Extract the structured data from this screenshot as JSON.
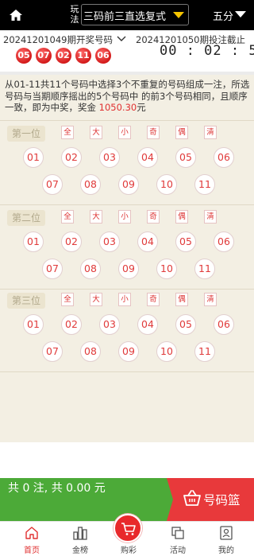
{
  "header": {
    "play_label": "玩法",
    "play_type": "三码前三直选复式",
    "game": "五分"
  },
  "draw": {
    "prev_issue": "20241201049期开奖号码",
    "prev_numbers": [
      "05",
      "07",
      "02",
      "11",
      "06"
    ],
    "current_issue": "20241201050期投注截止",
    "countdown": "00 : 02 : 54"
  },
  "description": {
    "text": "从01-11共11个号码中选择3个不重复的号码组成一注，所选号码与当期顺序摇出的5个号码中 的前3个号码相同，且顺序一致，即为中奖，奖金 ",
    "prize": "1050.30",
    "suffix": "元"
  },
  "filters": [
    "全",
    "大",
    "小",
    "奇",
    "偶",
    "清"
  ],
  "positions": [
    {
      "label": "第一位",
      "numbers": [
        "01",
        "02",
        "03",
        "04",
        "05",
        "06",
        "07",
        "08",
        "09",
        "10",
        "11"
      ]
    },
    {
      "label": "第二位",
      "numbers": [
        "01",
        "02",
        "03",
        "04",
        "05",
        "06",
        "07",
        "08",
        "09",
        "10",
        "11"
      ]
    },
    {
      "label": "第三位",
      "numbers": [
        "01",
        "02",
        "03",
        "04",
        "05",
        "06",
        "07",
        "08",
        "09",
        "10",
        "11"
      ]
    }
  ],
  "bet": {
    "summary": "共 0 注, 共 0.00 元",
    "basket_label": "号码篮"
  },
  "tabs": [
    {
      "label": "首页",
      "icon": "home-icon"
    },
    {
      "label": "金榜",
      "icon": "leaderboard-icon"
    },
    {
      "label": "购彩",
      "icon": "cart-icon"
    },
    {
      "label": "活动",
      "icon": "activity-icon"
    },
    {
      "label": "我的",
      "icon": "profile-icon"
    }
  ],
  "colors": {
    "accent_red": "#e8393b",
    "bet_green": "#4caa38",
    "countdown_text": "#222222",
    "play_area_bg": "#f3efe3"
  }
}
